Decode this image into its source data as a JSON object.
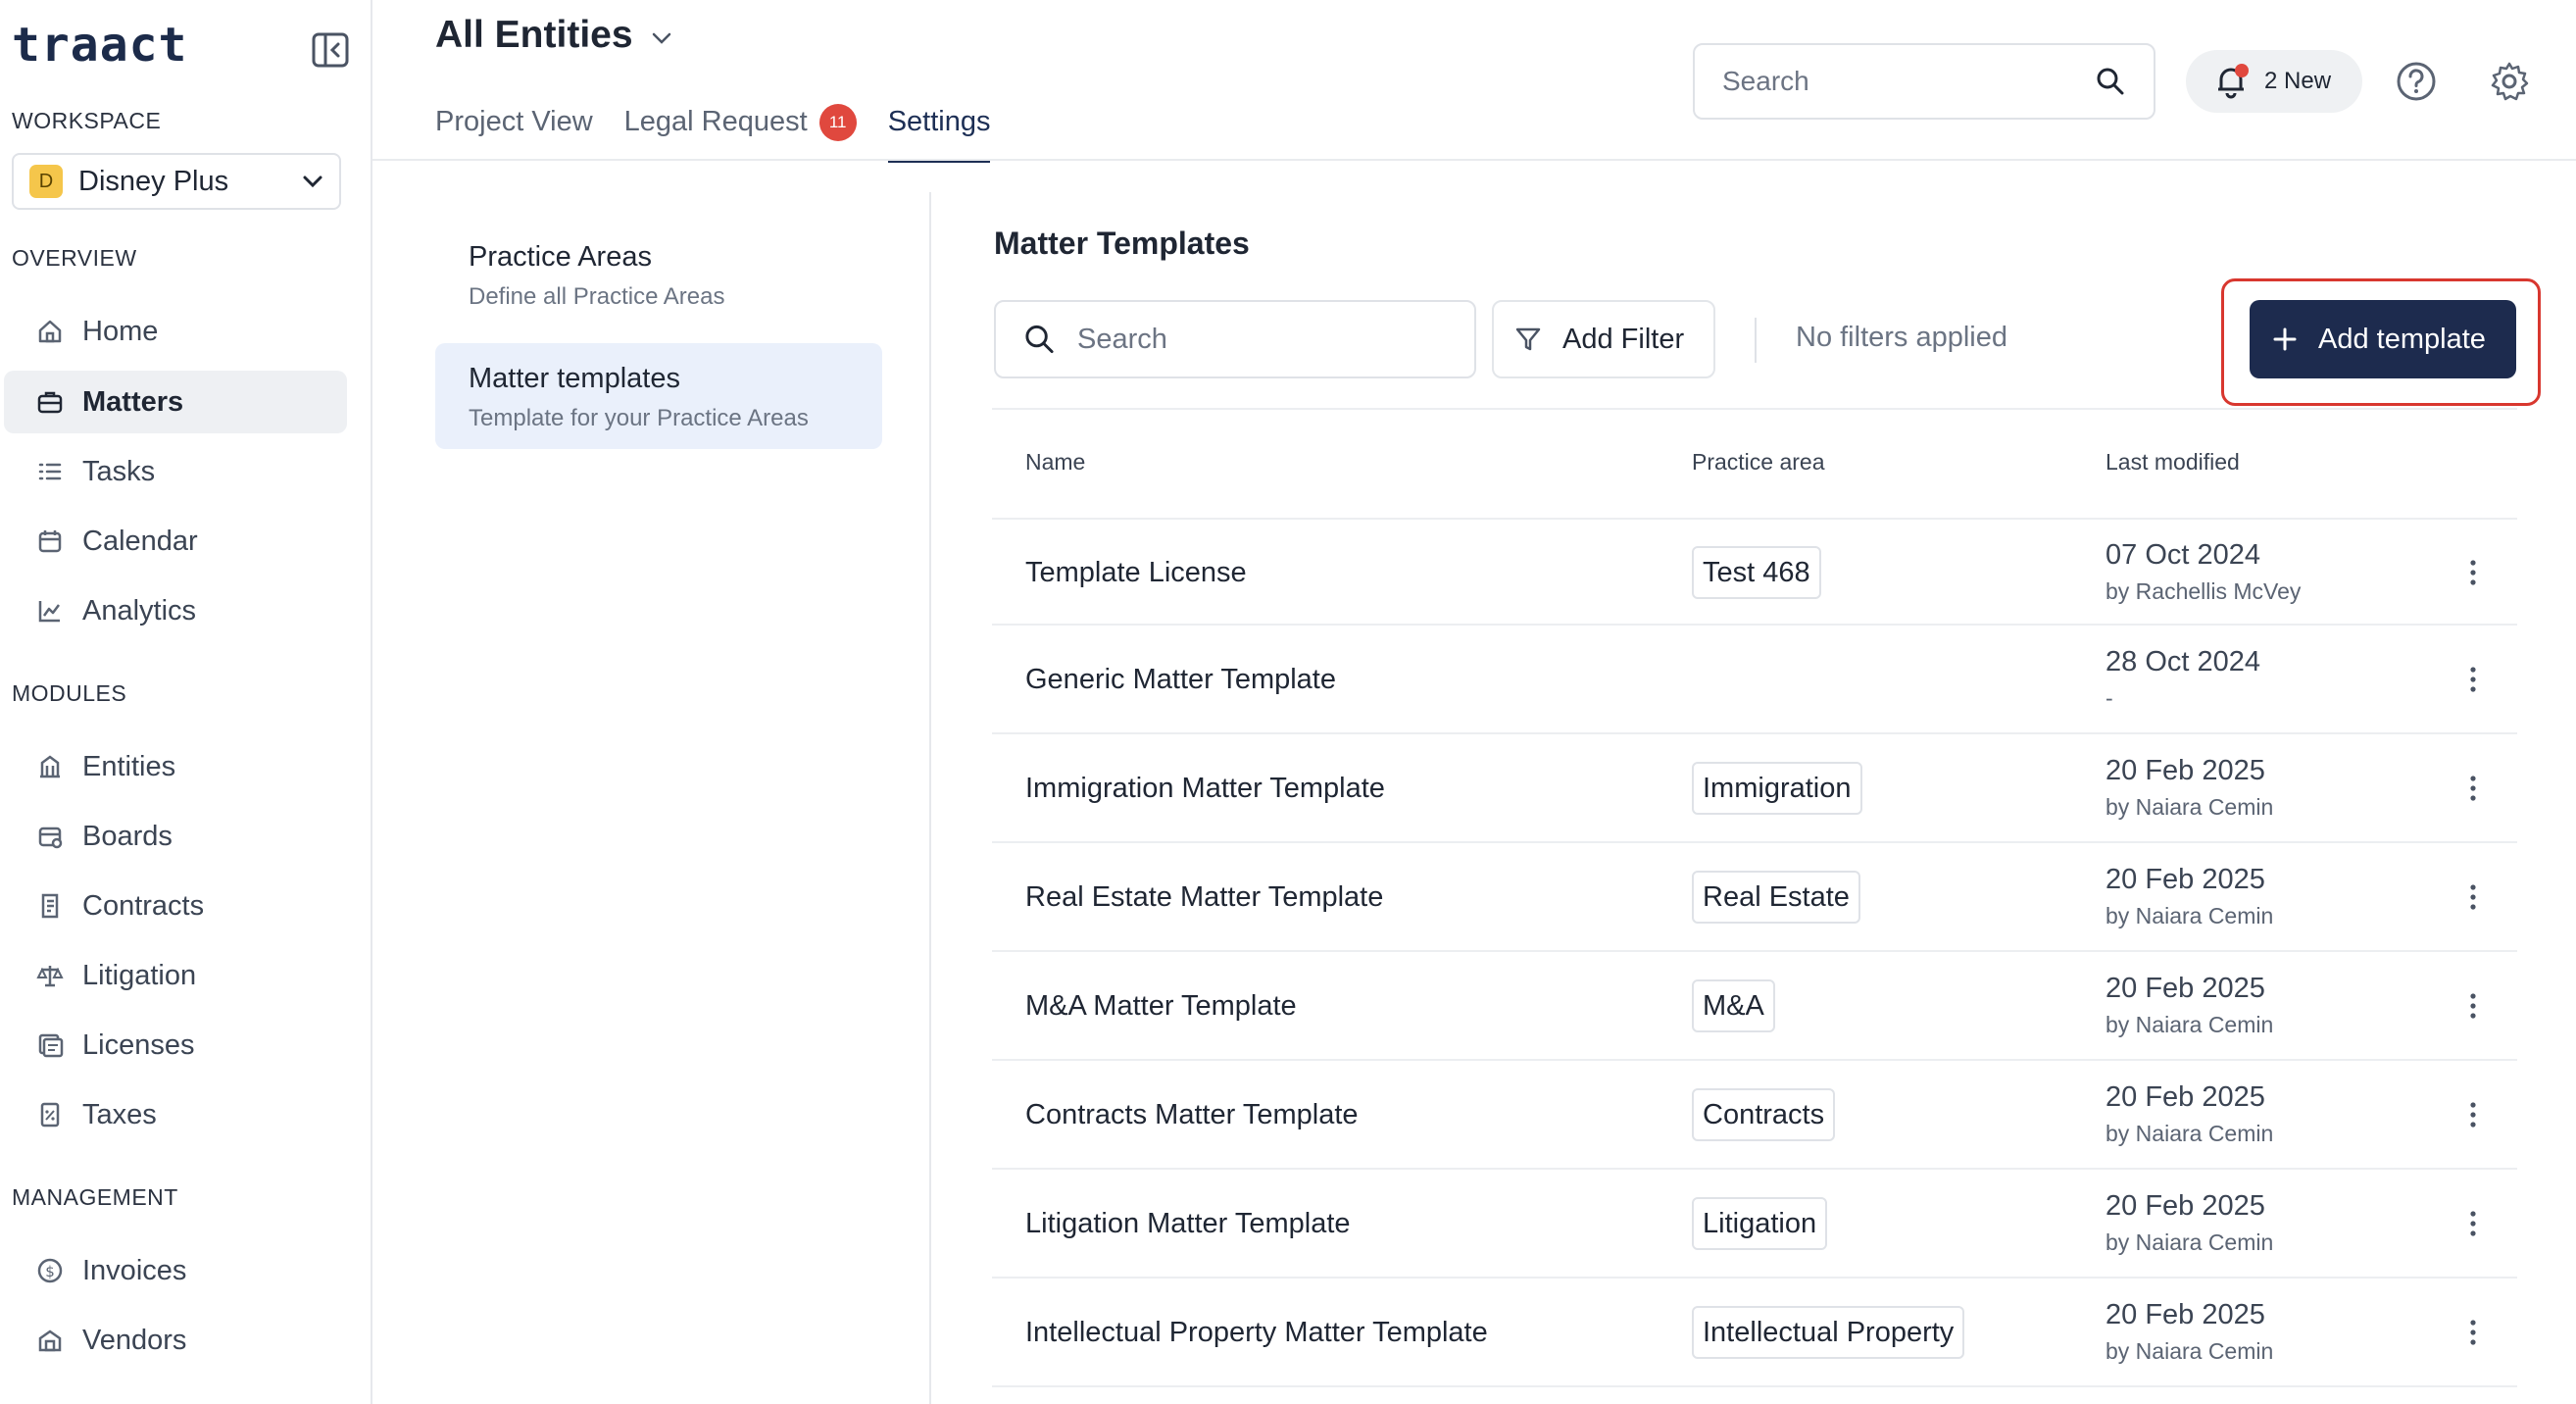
{
  "app": {
    "logo": "traact",
    "workspace_label": "WORKSPACE",
    "workspace": {
      "badge": "D",
      "name": "Disney Plus"
    },
    "colors": {
      "primary": "#1d2b4e",
      "badge_red": "#e0483e",
      "active_bg": "#eaf0fb"
    }
  },
  "sidebar": {
    "overview_label": "OVERVIEW",
    "overview": [
      {
        "label": "Home",
        "icon": "home-icon"
      },
      {
        "label": "Matters",
        "icon": "briefcase-icon",
        "active": true
      },
      {
        "label": "Tasks",
        "icon": "list-icon"
      },
      {
        "label": "Calendar",
        "icon": "calendar-icon"
      },
      {
        "label": "Analytics",
        "icon": "chart-icon"
      }
    ],
    "modules_label": "MODULES",
    "modules": [
      {
        "label": "Entities",
        "icon": "building-icon"
      },
      {
        "label": "Boards",
        "icon": "board-icon"
      },
      {
        "label": "Contracts",
        "icon": "contract-icon"
      },
      {
        "label": "Litigation",
        "icon": "scale-icon"
      },
      {
        "label": "Licenses",
        "icon": "license-icon"
      },
      {
        "label": "Taxes",
        "icon": "tax-icon"
      }
    ],
    "management_label": "MANAGEMENT",
    "management": [
      {
        "label": "Invoices",
        "icon": "dollar-icon"
      },
      {
        "label": "Vendors",
        "icon": "vendor-icon"
      }
    ]
  },
  "header": {
    "title": "All Entities",
    "tabs": [
      {
        "label": "Project View"
      },
      {
        "label": "Legal Request",
        "badge": "11"
      },
      {
        "label": "Settings",
        "active": true
      }
    ],
    "search_placeholder": "Search",
    "notifications_label": "2 New"
  },
  "settings_nav": [
    {
      "title": "Practice Areas",
      "desc": "Define all Practice Areas"
    },
    {
      "title": "Matter templates",
      "desc": "Template for your Practice Areas",
      "active": true
    }
  ],
  "main": {
    "title": "Matter Templates",
    "search_placeholder": "Search",
    "add_filter_label": "Add Filter",
    "no_filters_label": "No filters applied",
    "add_template_label": "Add template",
    "columns": {
      "name": "Name",
      "practice_area": "Practice area",
      "last_modified": "Last modified"
    },
    "rows": [
      {
        "name": "Template License",
        "area": "Test 468",
        "date": "07 Oct 2024",
        "by": "by Rachellis McVey"
      },
      {
        "name": "Generic Matter Template",
        "area": "",
        "date": "28 Oct 2024",
        "by": "-"
      },
      {
        "name": "Immigration Matter Template",
        "area": "Immigration",
        "date": "20 Feb 2025",
        "by": "by Naiara Cemin"
      },
      {
        "name": "Real Estate Matter Template",
        "area": "Real Estate",
        "date": "20 Feb 2025",
        "by": "by Naiara Cemin"
      },
      {
        "name": "M&A Matter Template",
        "area": "M&A",
        "date": "20 Feb 2025",
        "by": "by Naiara Cemin"
      },
      {
        "name": "Contracts Matter Template",
        "area": "Contracts",
        "date": "20 Feb 2025",
        "by": "by Naiara Cemin"
      },
      {
        "name": "Litigation Matter Template",
        "area": "Litigation",
        "date": "20 Feb 2025",
        "by": "by Naiara Cemin"
      },
      {
        "name": "Intellectual Property Matter Template",
        "area": "Intellectual Property",
        "date": "20 Feb 2025",
        "by": "by Naiara Cemin"
      }
    ]
  }
}
